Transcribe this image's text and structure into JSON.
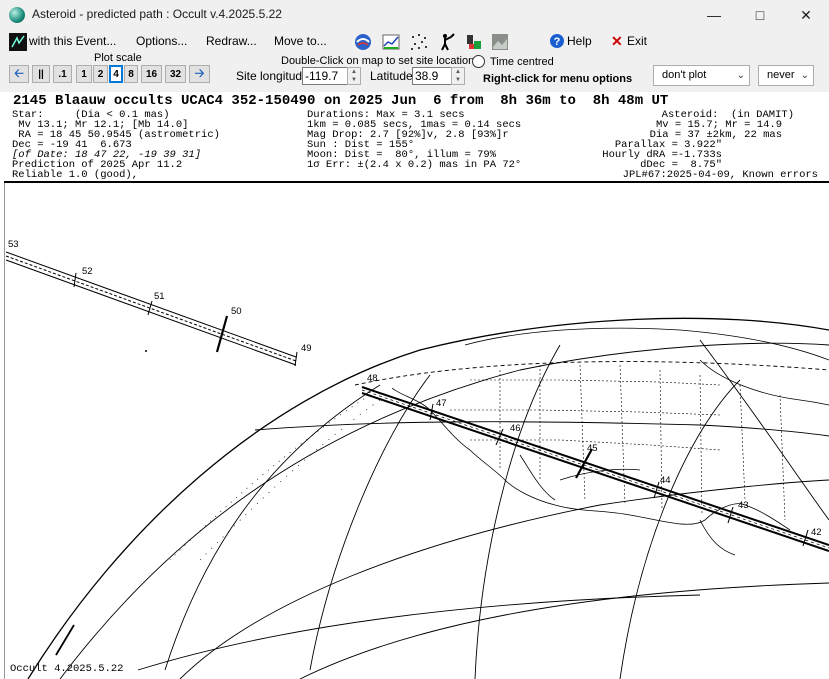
{
  "window": {
    "title": "Asteroid - predicted path : Occult v.4.2025.5.22",
    "min_icon": "minimize-icon",
    "max_icon": "maximize-icon",
    "close_icon": "close-icon"
  },
  "menu": {
    "with_event": "with this Event...",
    "options": "Options...",
    "redraw": "Redraw...",
    "move_to": "Move to...",
    "help": "Help",
    "exit": "Exit"
  },
  "controls": {
    "plot_scale_label": "Plot scale",
    "scale_buttons": [
      ".1",
      "1",
      "2",
      "4",
      "8",
      "16",
      "32"
    ],
    "selected_scale": "4",
    "double_click_hint": "Double-Click on map to set site location",
    "time_centred_label": "Time centred",
    "site_longitude_label": "Site longitude",
    "site_longitude_value": "-119.7",
    "latitude_label": "Latitude",
    "latitude_value": "38.9",
    "right_click_hint": "Right-click for menu options",
    "plot_select": "don't plot",
    "never_select": "never"
  },
  "header": {
    "title": "2145 Blaauw occults UCAC4 352-150490 on 2025 Jun  6 from  8h 36m to  8h 48m UT",
    "left_lines": [
      "Star:     (Dia < 0.1 mas)",
      " Mv 13.1; Mr 12.1; [Mb 14.0]",
      " RA = 18 45 50.9545 (astrometric)",
      "Dec = -19 41  6.673",
      "[of Date: 18 47 22, -19 39 31]",
      "Prediction of 2025 Apr 11.2",
      "Reliable 1.0 (good),"
    ],
    "mid_lines": [
      "Durations: Max = 3.1 secs",
      "1km = 0.085 secs, 1mas = 0.14 secs",
      "Mag Drop: 2.7 [92%]v, 2.8 [93%]r",
      "Sun : Dist = 155°",
      "Moon: Dist =  80°, illum = 79%",
      "1σ Err: ±(2.4 x 0.2) mas in PA 72°"
    ],
    "right_lines": [
      "Asteroid:  (in DAMIT)",
      "Mv = 15.7; Mr = 14.9",
      "Dia = 37 ±2km, 22 mas",
      "Parallax = 3.922\"",
      "Hourly dRA =-1.733s",
      "dDec =  8.75\"",
      "JPL#67:2025-04-09, Known errors"
    ]
  },
  "map": {
    "time_labels": [
      "53",
      "52",
      "51",
      "50",
      "49",
      "48",
      "47",
      "46",
      "45",
      "44",
      "43",
      "42"
    ],
    "footer": "Occult 4.2025.5.22"
  }
}
